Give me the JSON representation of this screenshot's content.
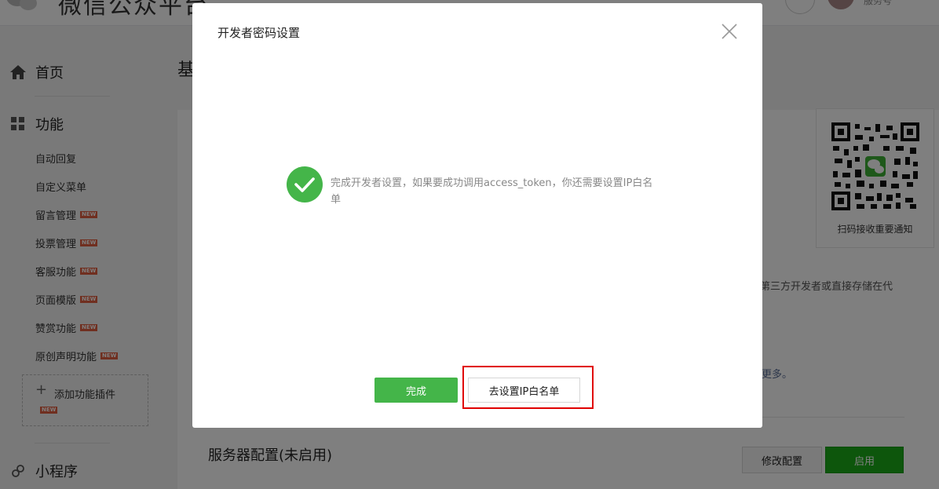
{
  "header": {
    "logo_text": "微信公众平台",
    "account_type": "服务号"
  },
  "sidebar": {
    "home": "首页",
    "features": "功能",
    "items": [
      {
        "label": "自动回复",
        "new": false
      },
      {
        "label": "自定义菜单",
        "new": false
      },
      {
        "label": "留言管理",
        "new": true
      },
      {
        "label": "投票管理",
        "new": true
      },
      {
        "label": "客服功能",
        "new": true
      },
      {
        "label": "页面模版",
        "new": true
      },
      {
        "label": "赞赏功能",
        "new": true
      },
      {
        "label": "原创声明功能",
        "new": true
      }
    ],
    "add_plugin": "添加功能插件",
    "new_badge": "NEW",
    "mini_program": "小程序"
  },
  "content": {
    "title": "基",
    "qr_caption": "扫码接收重要通知",
    "partial_text": "第三方开发者或直接存储在代",
    "partial_link": "更多。",
    "server_title": "服务器配置(未启用)",
    "modify_button": "修改配置",
    "enable_button": "启用"
  },
  "dialog": {
    "title": "开发者密码设置",
    "message": "完成开发者设置，如果要成功调用access_token，你还需要设置IP白名单",
    "done_button": "完成",
    "ip_button": "去设置IP白名单"
  },
  "colors": {
    "primary_green": "#44b549",
    "highlight_red": "#e00000",
    "new_badge": "#e15f40"
  }
}
